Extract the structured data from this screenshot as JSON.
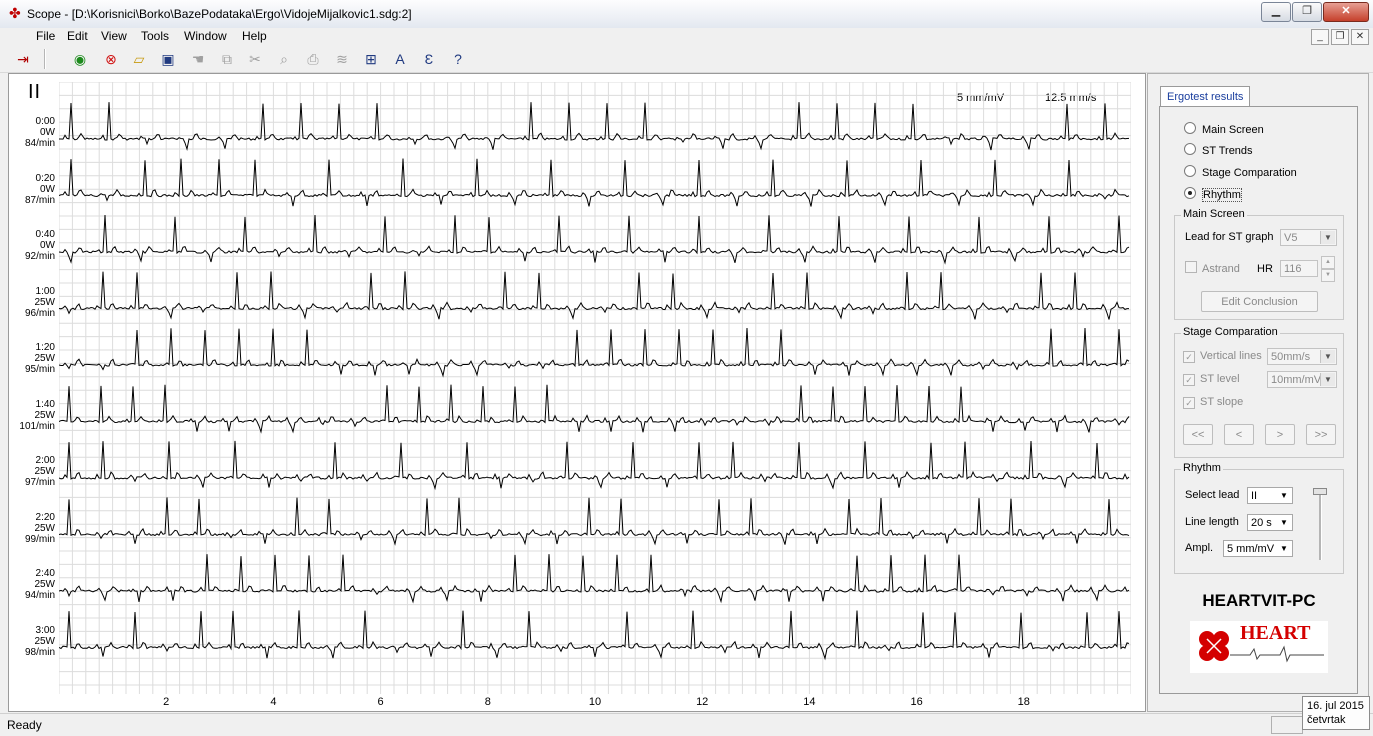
{
  "window": {
    "title": "Scope - [D:\\Korisnici\\Borko\\BazePodataka\\Ergo\\VidojeMijalkovic1.sdg:2]",
    "controls": [
      "minimize",
      "maximize",
      "close"
    ]
  },
  "menu": [
    "File",
    "Edit",
    "View",
    "Tools",
    "Window",
    "Help"
  ],
  "toolbar": {
    "icons": [
      "exit-icon",
      "record-icon",
      "stop-icon",
      "open-folder-icon",
      "save-icon",
      "hand-icon",
      "copy-icon",
      "cut-icon",
      "preview-icon",
      "print-icon",
      "filter-icon",
      "grid-icon",
      "font-icon",
      "text-icon",
      "help-icon"
    ]
  },
  "ecg": {
    "lead": "II",
    "amplitude_scale": "5 mm/mV",
    "speed_scale": "12.5 mm/s",
    "rows": [
      {
        "time": "0:00",
        "load": "0W",
        "hr": "84/min"
      },
      {
        "time": "0:20",
        "load": "0W",
        "hr": "87/min"
      },
      {
        "time": "0:40",
        "load": "0W",
        "hr": "92/min"
      },
      {
        "time": "1:00",
        "load": "25W",
        "hr": "96/min"
      },
      {
        "time": "1:20",
        "load": "25W",
        "hr": "95/min"
      },
      {
        "time": "1:40",
        "load": "25W",
        "hr": "101/min"
      },
      {
        "time": "2:00",
        "load": "25W",
        "hr": "97/min"
      },
      {
        "time": "2:20",
        "load": "25W",
        "hr": "99/min"
      },
      {
        "time": "2:40",
        "load": "25W",
        "hr": "94/min"
      },
      {
        "time": "3:00",
        "load": "25W",
        "hr": "98/min"
      }
    ],
    "x_ticks": [
      "2",
      "4",
      "6",
      "8",
      "10",
      "12",
      "14",
      "16",
      "18"
    ]
  },
  "panel": {
    "tab_label": "Ergotest results",
    "views": [
      {
        "label": "Main Screen",
        "selected": false
      },
      {
        "label": "ST Trends",
        "selected": false
      },
      {
        "label": "Stage Comparation",
        "selected": false
      },
      {
        "label": "Rhythm",
        "selected": true
      }
    ],
    "main_screen": {
      "title": "Main Screen",
      "lead_label": "Lead for ST graph",
      "lead_value": "V5",
      "astrand_label": "Astrand",
      "hr_label": "HR",
      "hr_value": "116",
      "edit_conclusion": "Edit Conclusion"
    },
    "stage_comparation": {
      "title": "Stage Comparation",
      "vertical_lines_label": "Vertical lines",
      "vertical_lines_value": "50mm/s",
      "st_level_label": "ST level",
      "st_level_value": "10mm/mV",
      "st_slope_label": "ST slope",
      "nav_first": "<<",
      "nav_prev": "<",
      "nav_next": ">",
      "nav_last": ">>"
    },
    "rhythm": {
      "title": "Rhythm",
      "select_lead_label": "Select lead",
      "select_lead_value": "II",
      "line_length_label": "Line length",
      "line_length_value": "20 s",
      "ampl_label": "Ampl.",
      "ampl_value": "5 mm/mV"
    },
    "brand": "HEARTVIT-PC",
    "logo_text": "HEART"
  },
  "status": {
    "text": "Ready",
    "date": "16. jul 2015",
    "day": "četvrtak"
  },
  "colors": {
    "accent_tab": "#1a3e9e",
    "logo_red": "#d40000",
    "grid": "#dcdcdc"
  }
}
